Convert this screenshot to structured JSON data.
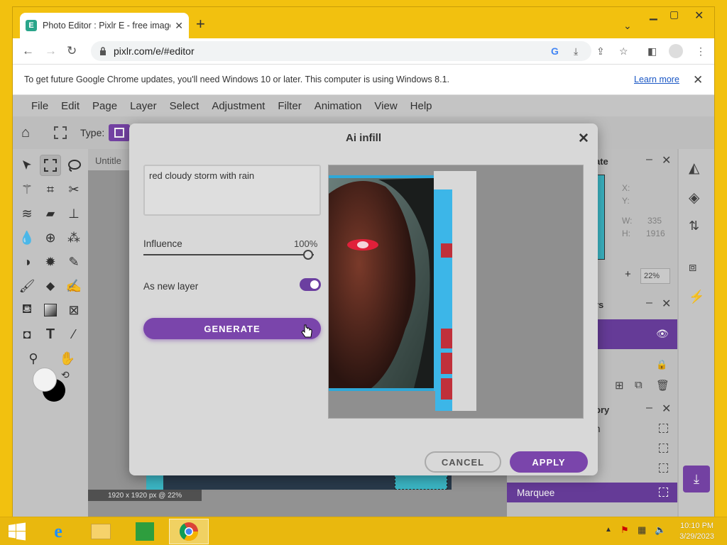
{
  "browser": {
    "tab_title": "Photo Editor : Pixlr E - free image",
    "favicon_letter": "E",
    "url": "pixlr.com/e/#editor",
    "infobar_message": "To get future Google Chrome updates, you'll need Windows 10 or later. This computer is using Windows 8.1.",
    "learn_more": "Learn more"
  },
  "menu": [
    "File",
    "Edit",
    "Page",
    "Layer",
    "Select",
    "Adjustment",
    "Filter",
    "Animation",
    "View",
    "Help"
  ],
  "options_bar": {
    "type_label": "Type:"
  },
  "canvas": {
    "tab_title": "Untitle",
    "status": "1920 x 1920 px @ 22%"
  },
  "right_panel": {
    "navigator": {
      "title": "ate",
      "x_label": "X:",
      "y_label": "Y:",
      "w_label": "W:",
      "w_value": "335",
      "h_label": "H:",
      "h_value": "1916",
      "zoom": "22%"
    },
    "layers": {
      "title": "rs"
    },
    "history": {
      "title": "ory",
      "items": [
        "n",
        "",
        "",
        "Marquee"
      ]
    }
  },
  "dialog": {
    "title": "Ai infill",
    "prompt_text": "red cloudy storm with rain",
    "influence_label": "Influence",
    "influence_value": "100%",
    "influence_percent": 100,
    "as_new_layer_label": "As new layer",
    "as_new_layer_on": true,
    "generate_label": "GENERATE",
    "cancel_label": "CANCEL",
    "apply_label": "APPLY"
  },
  "taskbar": {
    "time": "10:10 PM",
    "date": "3/29/2023"
  },
  "colors": {
    "accent": "#7a45ab",
    "desktop": "#f2c10f"
  }
}
